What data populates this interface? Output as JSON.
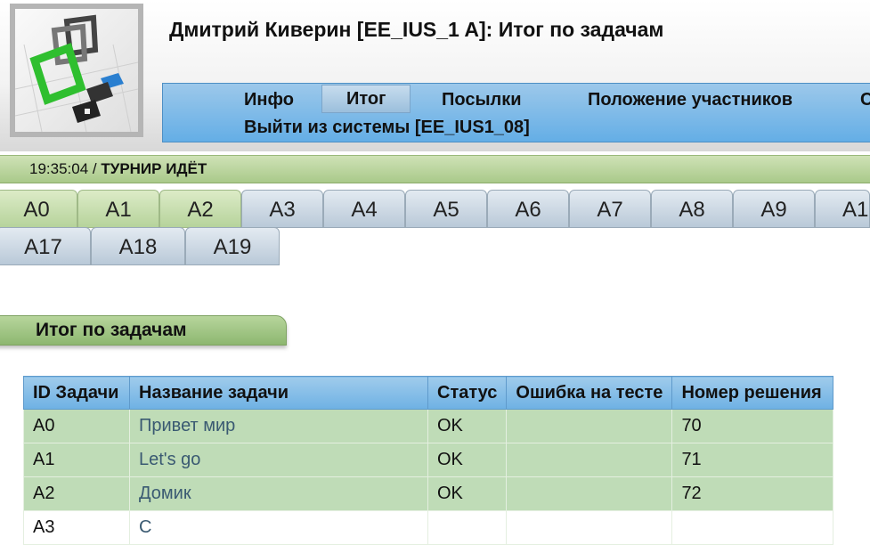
{
  "header": {
    "title": "Дмитрий Киверин [EE_IUS_1 A]: Итог по задачам"
  },
  "menu": {
    "items": [
      {
        "label": "Инфо"
      },
      {
        "label": "Итог",
        "active": true
      },
      {
        "label": "Посылки"
      },
      {
        "label": "Положение участников"
      },
      {
        "label": "С"
      }
    ],
    "logout": "Выйти из системы [EE_IUS1_08]"
  },
  "status": {
    "time": "19:35:04 /",
    "state": "ТУРНИР ИДЁТ"
  },
  "tabs": [
    {
      "label": "A0",
      "solved": true
    },
    {
      "label": "A1",
      "solved": true
    },
    {
      "label": "A2",
      "solved": true
    },
    {
      "label": "A3"
    },
    {
      "label": "A4"
    },
    {
      "label": "A5"
    },
    {
      "label": "A6"
    },
    {
      "label": "A7"
    },
    {
      "label": "A8"
    },
    {
      "label": "A9"
    },
    {
      "label": "A1"
    },
    {
      "label": "A17"
    },
    {
      "label": "A18"
    },
    {
      "label": "A19"
    }
  ],
  "section": {
    "title": "Итог по задачам"
  },
  "table": {
    "headers": [
      "ID Задачи",
      "Название задачи",
      "Статус",
      "Ошибка на тесте",
      "Номер решения"
    ],
    "rows": [
      {
        "id": "A0",
        "name": "Привет мир",
        "status": "OK",
        "failed_test": "",
        "run_id": "70"
      },
      {
        "id": "A1",
        "name": "Let's go",
        "status": "OK",
        "failed_test": "",
        "run_id": "71"
      },
      {
        "id": "A2",
        "name": "Домик",
        "status": "OK",
        "failed_test": "",
        "run_id": "72"
      },
      {
        "id": "A3",
        "name": "С",
        "status": "",
        "failed_test": "",
        "run_id": ""
      }
    ]
  },
  "colors": {
    "menu_blue": "#64aee6",
    "solved_green": "#b6d39b",
    "row_green": "#bfdcb7"
  }
}
